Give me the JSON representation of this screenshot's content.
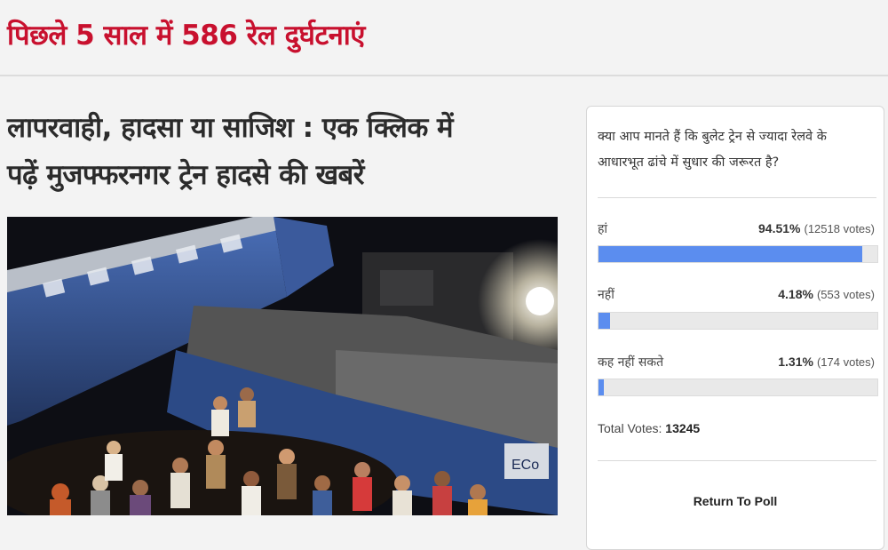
{
  "page": {
    "top_title": "पिछले 5 साल में 586 रेल दुर्घटनाएं",
    "headline_line1": "लापरवाही, हादसा या साजिश : एक क्लिक में",
    "headline_line2": "पढ़ें मुजफ्फरनगर ट्रेन हादसे की खबरें"
  },
  "photo": {
    "coach_marking": "ECo"
  },
  "poll": {
    "question_line1": "क्या आप मानते हैं कि बुलेट ट्रेन से ज्यादा रेलवे के",
    "question_line2": "आधारभूत ढांचे में सुधार की जरूरत है?",
    "options": [
      {
        "label": "हां",
        "percent_text": "94.51%",
        "votes_text": "(12518 votes)",
        "fraction": 0.9451
      },
      {
        "label": "नहीं",
        "percent_text": "4.18%",
        "votes_text": "(553 votes)",
        "fraction": 0.0418
      },
      {
        "label": "कह नहीं सकते",
        "percent_text": "1.31%",
        "votes_text": "(174 votes)",
        "fraction": 0.0131
      }
    ],
    "total_label": "Total Votes:",
    "total_value": "13245",
    "return_label": "Return To Poll",
    "bar_color": "#5b8def"
  },
  "colors": {
    "title_red": "#c8102e",
    "headline": "#2b2b2b"
  }
}
